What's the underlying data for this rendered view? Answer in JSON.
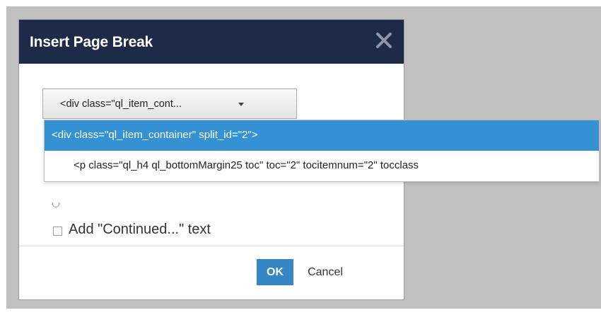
{
  "dialog": {
    "title": "Insert Page Break",
    "header_color": "#1e2b48",
    "close_icon": "close-icon"
  },
  "element_select": {
    "selected_value": "<div class=\"ql_item_cont...",
    "caret_icon": "caret-down-icon"
  },
  "dropdown": {
    "selection_color": "#3492d4",
    "items": [
      {
        "label": "<div class=\"ql_item_container\" split_id=\"2\">",
        "selected": true
      },
      {
        "label": "<p class=\"ql_h4 ql_bottomMargin25 toc\" toc=\"2\" tocitemnum=\"2\" tocclass",
        "selected": false
      }
    ]
  },
  "continued_option": {
    "label": "Add \"Continued...\" text",
    "checked": false
  },
  "footer": {
    "ok_label": "OK",
    "cancel_label": "Cancel",
    "ok_color": "#3487c4"
  }
}
